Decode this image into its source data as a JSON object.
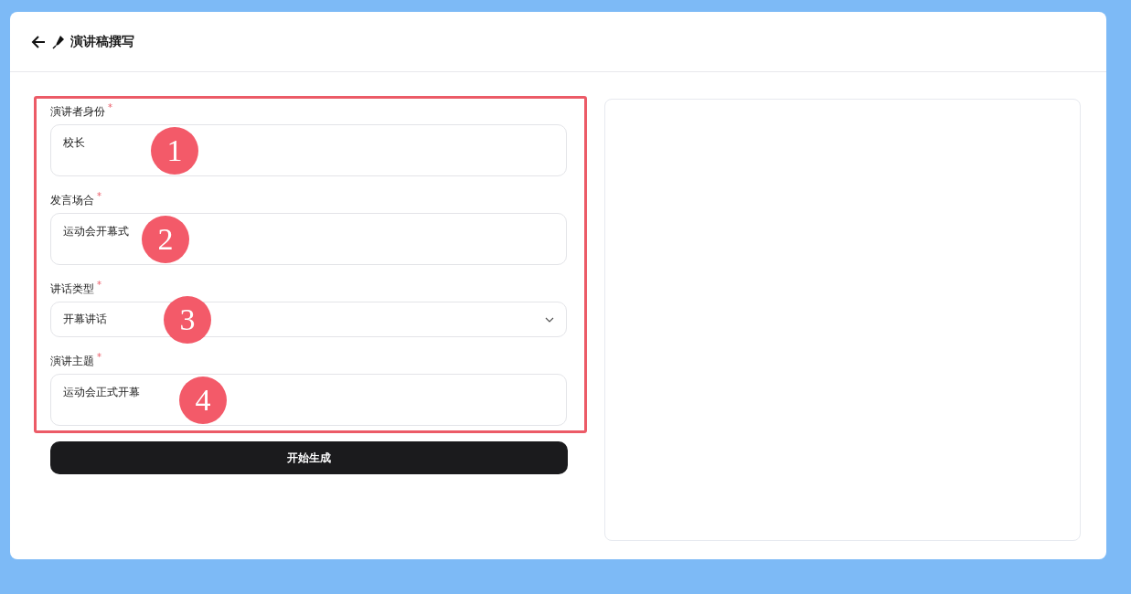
{
  "header": {
    "title": "演讲稿撰写"
  },
  "form": {
    "fields": [
      {
        "kind": "textarea",
        "label": "演讲者身份",
        "required_mark": "*",
        "value": "校长",
        "callout": "1"
      },
      {
        "kind": "textarea",
        "label": "发言场合",
        "required_mark": "*",
        "value": "运动会开幕式",
        "callout": "2"
      },
      {
        "kind": "select",
        "label": "讲话类型",
        "required_mark": "*",
        "value": "开幕讲话",
        "callout": "3"
      },
      {
        "kind": "textarea",
        "label": "演讲主题",
        "required_mark": "*",
        "value": "运动会正式开幕",
        "callout": "4"
      }
    ],
    "submit": "开始生成"
  }
}
